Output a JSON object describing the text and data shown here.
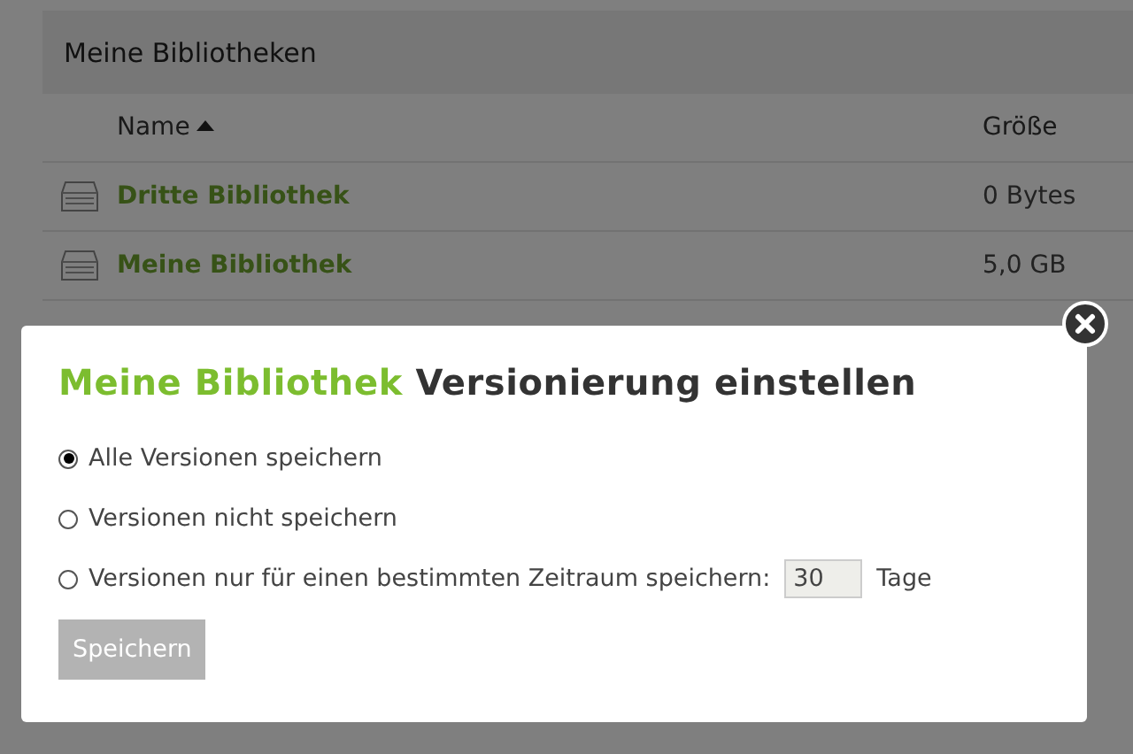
{
  "panel": {
    "title": "Meine Bibliotheken"
  },
  "table": {
    "columns": [
      {
        "label": "Name",
        "sorted": true
      },
      {
        "label": "Größe",
        "sorted": false
      }
    ],
    "rows": [
      {
        "name": "Dritte Bibliothek",
        "size": "0 Bytes"
      },
      {
        "name": "Meine Bibliothek",
        "size": "5,0 GB"
      }
    ]
  },
  "dialog": {
    "library_name": "Meine Bibliothek",
    "title": "Versionierung einstellen",
    "options": [
      {
        "kind": "plain",
        "label": "Alle Versionen speichern",
        "selected": true
      },
      {
        "kind": "plain",
        "label": "Versionen nicht speichern",
        "selected": false
      },
      {
        "kind": "days",
        "label": "Versionen nur für einen bestimmten Zeitraum speichern:",
        "value": "30",
        "unit": "Tage",
        "selected": false
      }
    ],
    "button": {
      "label": "Speichern",
      "disabled": true
    }
  }
}
